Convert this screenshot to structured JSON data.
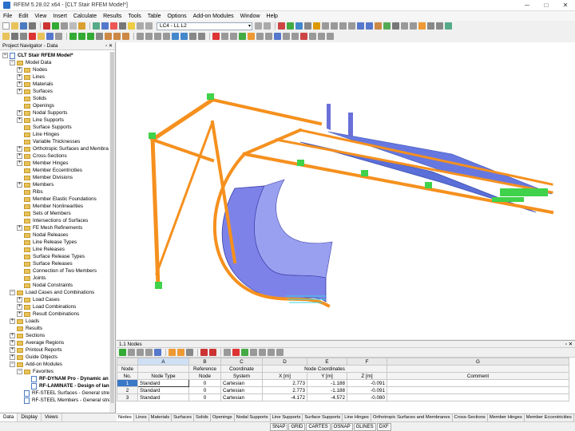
{
  "window": {
    "title": "RFEM 5.28.02 x64 - [CLT Stair RFEM Model*]",
    "controls": [
      "─",
      "□",
      "✕"
    ]
  },
  "menu": [
    "File",
    "Edit",
    "View",
    "Insert",
    "Calculate",
    "Results",
    "Tools",
    "Table",
    "Options",
    "Add-on Modules",
    "Window",
    "Help"
  ],
  "toolbar": {
    "load_case": "LC4 - LL L2"
  },
  "navigator": {
    "title": "Project Navigator - Data",
    "pins": "▫ ✕",
    "tree": [
      {
        "label": "CLT Stair RFEM Model*",
        "level": 0,
        "bold": true,
        "exp": "−",
        "icon": "doc"
      },
      {
        "label": "Model Data",
        "level": 1,
        "exp": "−",
        "icon": "folder"
      },
      {
        "label": "Nodes",
        "level": 2,
        "exp": "+",
        "icon": "folder"
      },
      {
        "label": "Lines",
        "level": 2,
        "exp": "+",
        "icon": "folder"
      },
      {
        "label": "Materials",
        "level": 2,
        "exp": "+",
        "icon": "folder"
      },
      {
        "label": "Surfaces",
        "level": 2,
        "exp": "+",
        "icon": "folder"
      },
      {
        "label": "Solids",
        "level": 2,
        "exp": "",
        "icon": "folder"
      },
      {
        "label": "Openings",
        "level": 2,
        "exp": "",
        "icon": "folder"
      },
      {
        "label": "Nodal Supports",
        "level": 2,
        "exp": "+",
        "icon": "folder"
      },
      {
        "label": "Line Supports",
        "level": 2,
        "exp": "+",
        "icon": "folder"
      },
      {
        "label": "Surface Supports",
        "level": 2,
        "exp": "",
        "icon": "folder"
      },
      {
        "label": "Line Hinges",
        "level": 2,
        "exp": "",
        "icon": "folder"
      },
      {
        "label": "Variable Thicknesses",
        "level": 2,
        "exp": "",
        "icon": "folder"
      },
      {
        "label": "Orthotropic Surfaces and Membra",
        "level": 2,
        "exp": "+",
        "icon": "folder"
      },
      {
        "label": "Cross-Sections",
        "level": 2,
        "exp": "+",
        "icon": "folder"
      },
      {
        "label": "Member Hinges",
        "level": 2,
        "exp": "+",
        "icon": "folder"
      },
      {
        "label": "Member Eccentricities",
        "level": 2,
        "exp": "",
        "icon": "folder"
      },
      {
        "label": "Member Divisions",
        "level": 2,
        "exp": "",
        "icon": "folder"
      },
      {
        "label": "Members",
        "level": 2,
        "exp": "+",
        "icon": "folder"
      },
      {
        "label": "Ribs",
        "level": 2,
        "exp": "",
        "icon": "folder"
      },
      {
        "label": "Member Elastic Foundations",
        "level": 2,
        "exp": "",
        "icon": "folder"
      },
      {
        "label": "Member Nonlinearities",
        "level": 2,
        "exp": "",
        "icon": "folder"
      },
      {
        "label": "Sets of Members",
        "level": 2,
        "exp": "",
        "icon": "folder"
      },
      {
        "label": "Intersections of Surfaces",
        "level": 2,
        "exp": "",
        "icon": "folder"
      },
      {
        "label": "FE Mesh Refinements",
        "level": 2,
        "exp": "+",
        "icon": "folder"
      },
      {
        "label": "Nodal Releases",
        "level": 2,
        "exp": "",
        "icon": "folder"
      },
      {
        "label": "Line Release Types",
        "level": 2,
        "exp": "",
        "icon": "folder"
      },
      {
        "label": "Line Releases",
        "level": 2,
        "exp": "",
        "icon": "folder"
      },
      {
        "label": "Surface Release Types",
        "level": 2,
        "exp": "",
        "icon": "folder"
      },
      {
        "label": "Surface Releases",
        "level": 2,
        "exp": "",
        "icon": "folder"
      },
      {
        "label": "Connection of Two Members",
        "level": 2,
        "exp": "",
        "icon": "folder"
      },
      {
        "label": "Joints",
        "level": 2,
        "exp": "",
        "icon": "folder"
      },
      {
        "label": "Nodal Constraints",
        "level": 2,
        "exp": "",
        "icon": "folder"
      },
      {
        "label": "Load Cases and Combinations",
        "level": 1,
        "exp": "−",
        "icon": "folder"
      },
      {
        "label": "Load Cases",
        "level": 2,
        "exp": "+",
        "icon": "folder"
      },
      {
        "label": "Load Combinations",
        "level": 2,
        "exp": "+",
        "icon": "folder"
      },
      {
        "label": "Result Combinations",
        "level": 2,
        "exp": "+",
        "icon": "folder"
      },
      {
        "label": "Loads",
        "level": 1,
        "exp": "+",
        "icon": "folder"
      },
      {
        "label": "Results",
        "level": 1,
        "exp": "",
        "icon": "folder"
      },
      {
        "label": "Sections",
        "level": 1,
        "exp": "+",
        "icon": "folder"
      },
      {
        "label": "Average Regions",
        "level": 1,
        "exp": "+",
        "icon": "folder"
      },
      {
        "label": "Printout Reports",
        "level": 1,
        "exp": "+",
        "icon": "folder"
      },
      {
        "label": "Guide Objects",
        "level": 1,
        "exp": "+",
        "icon": "folder"
      },
      {
        "label": "Add-on Modules",
        "level": 1,
        "exp": "−",
        "icon": "folder"
      },
      {
        "label": "Favorites",
        "level": 2,
        "exp": "−",
        "icon": "folder"
      },
      {
        "label": "RF-DYNAM Pro - Dynamic an",
        "level": 3,
        "exp": "",
        "icon": "doc",
        "bold": true
      },
      {
        "label": "RF-LAMINATE - Design of lan",
        "level": 3,
        "exp": "",
        "icon": "doc",
        "bold": true
      },
      {
        "label": "RF-STEEL Surfaces - General stress",
        "level": 2,
        "exp": "",
        "icon": "doc"
      },
      {
        "label": "RF-STEEL Members - General stress",
        "level": 2,
        "exp": "",
        "icon": "doc"
      }
    ],
    "tabs": [
      "Data",
      "Display",
      "Views"
    ]
  },
  "table": {
    "title": "1.1 Nodes",
    "pins": "▫ ✕",
    "columns": [
      "A",
      "B",
      "C",
      "D",
      "E",
      "F",
      "G"
    ],
    "header_row1": [
      "Node",
      "",
      "Reference",
      "Coordinate",
      "Node Coordinates",
      "",
      "",
      ""
    ],
    "header_row2": [
      "No.",
      "Node Type",
      "Node",
      "System",
      "X [m]",
      "Y [m]",
      "Z [m]",
      "Comment"
    ],
    "rows": [
      {
        "no": "1",
        "type": "Standard",
        "ref": "0",
        "sys": "Cartesian",
        "x": "2.773",
        "y": "-1.188",
        "z": "-0.091",
        "comment": ""
      },
      {
        "no": "2",
        "type": "Standard",
        "ref": "0",
        "sys": "Cartesian",
        "x": "2.773",
        "y": "-1.188",
        "z": "-0.091",
        "comment": ""
      },
      {
        "no": "3",
        "type": "Standard",
        "ref": "0",
        "sys": "Cartesian",
        "x": "-4.172",
        "y": "-4.572",
        "z": "-0.080",
        "comment": ""
      }
    ],
    "tabs": [
      "Nodes",
      "Lines",
      "Materials",
      "Surfaces",
      "Solids",
      "Openings",
      "Nodal Supports",
      "Line Supports",
      "Surface Supports",
      "Line Hinges",
      "Orthotropic Surfaces and Membranes",
      "Cross-Sections",
      "Member Hinges",
      "Member Eccentricities"
    ]
  },
  "statusbar": [
    "SNAP",
    "GRID",
    "CARTES",
    "OSNAP",
    "GLINES",
    "DXF"
  ],
  "colors": {
    "member": "#f5901e",
    "surface": "#5b6fd8",
    "support": "#3fd24a",
    "selection": "#3a78c8"
  }
}
